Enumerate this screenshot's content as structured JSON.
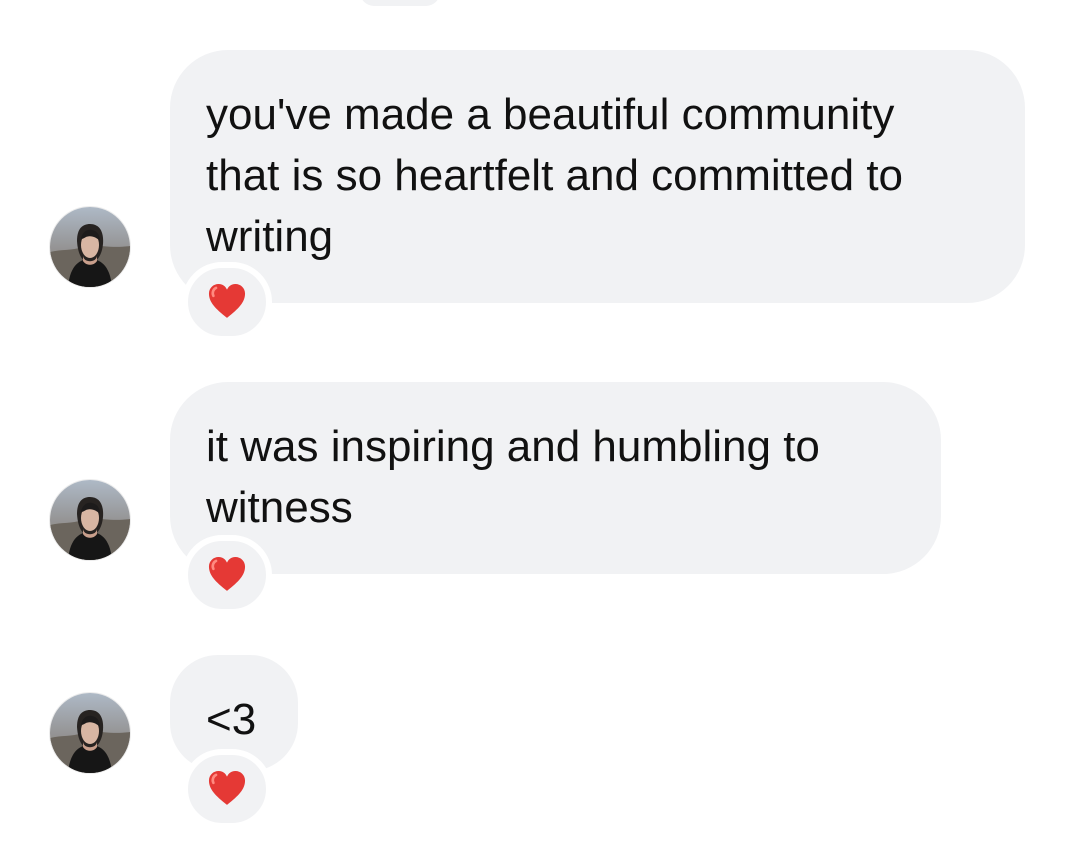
{
  "messages": [
    {
      "sender": "avatar",
      "text": "you've made a beautiful community that is so heartfelt and committed to writing",
      "reaction": "heart-emoji"
    },
    {
      "sender": "avatar",
      "text": "it was inspiring and humbling to witness",
      "reaction": "heart-emoji"
    },
    {
      "sender": "avatar",
      "text": "<3",
      "reaction": "heart-emoji"
    }
  ],
  "colors": {
    "bubble_background": "#f1f2f4",
    "text": "#111111",
    "reaction_heart": "#e53935",
    "page_background": "#ffffff"
  }
}
